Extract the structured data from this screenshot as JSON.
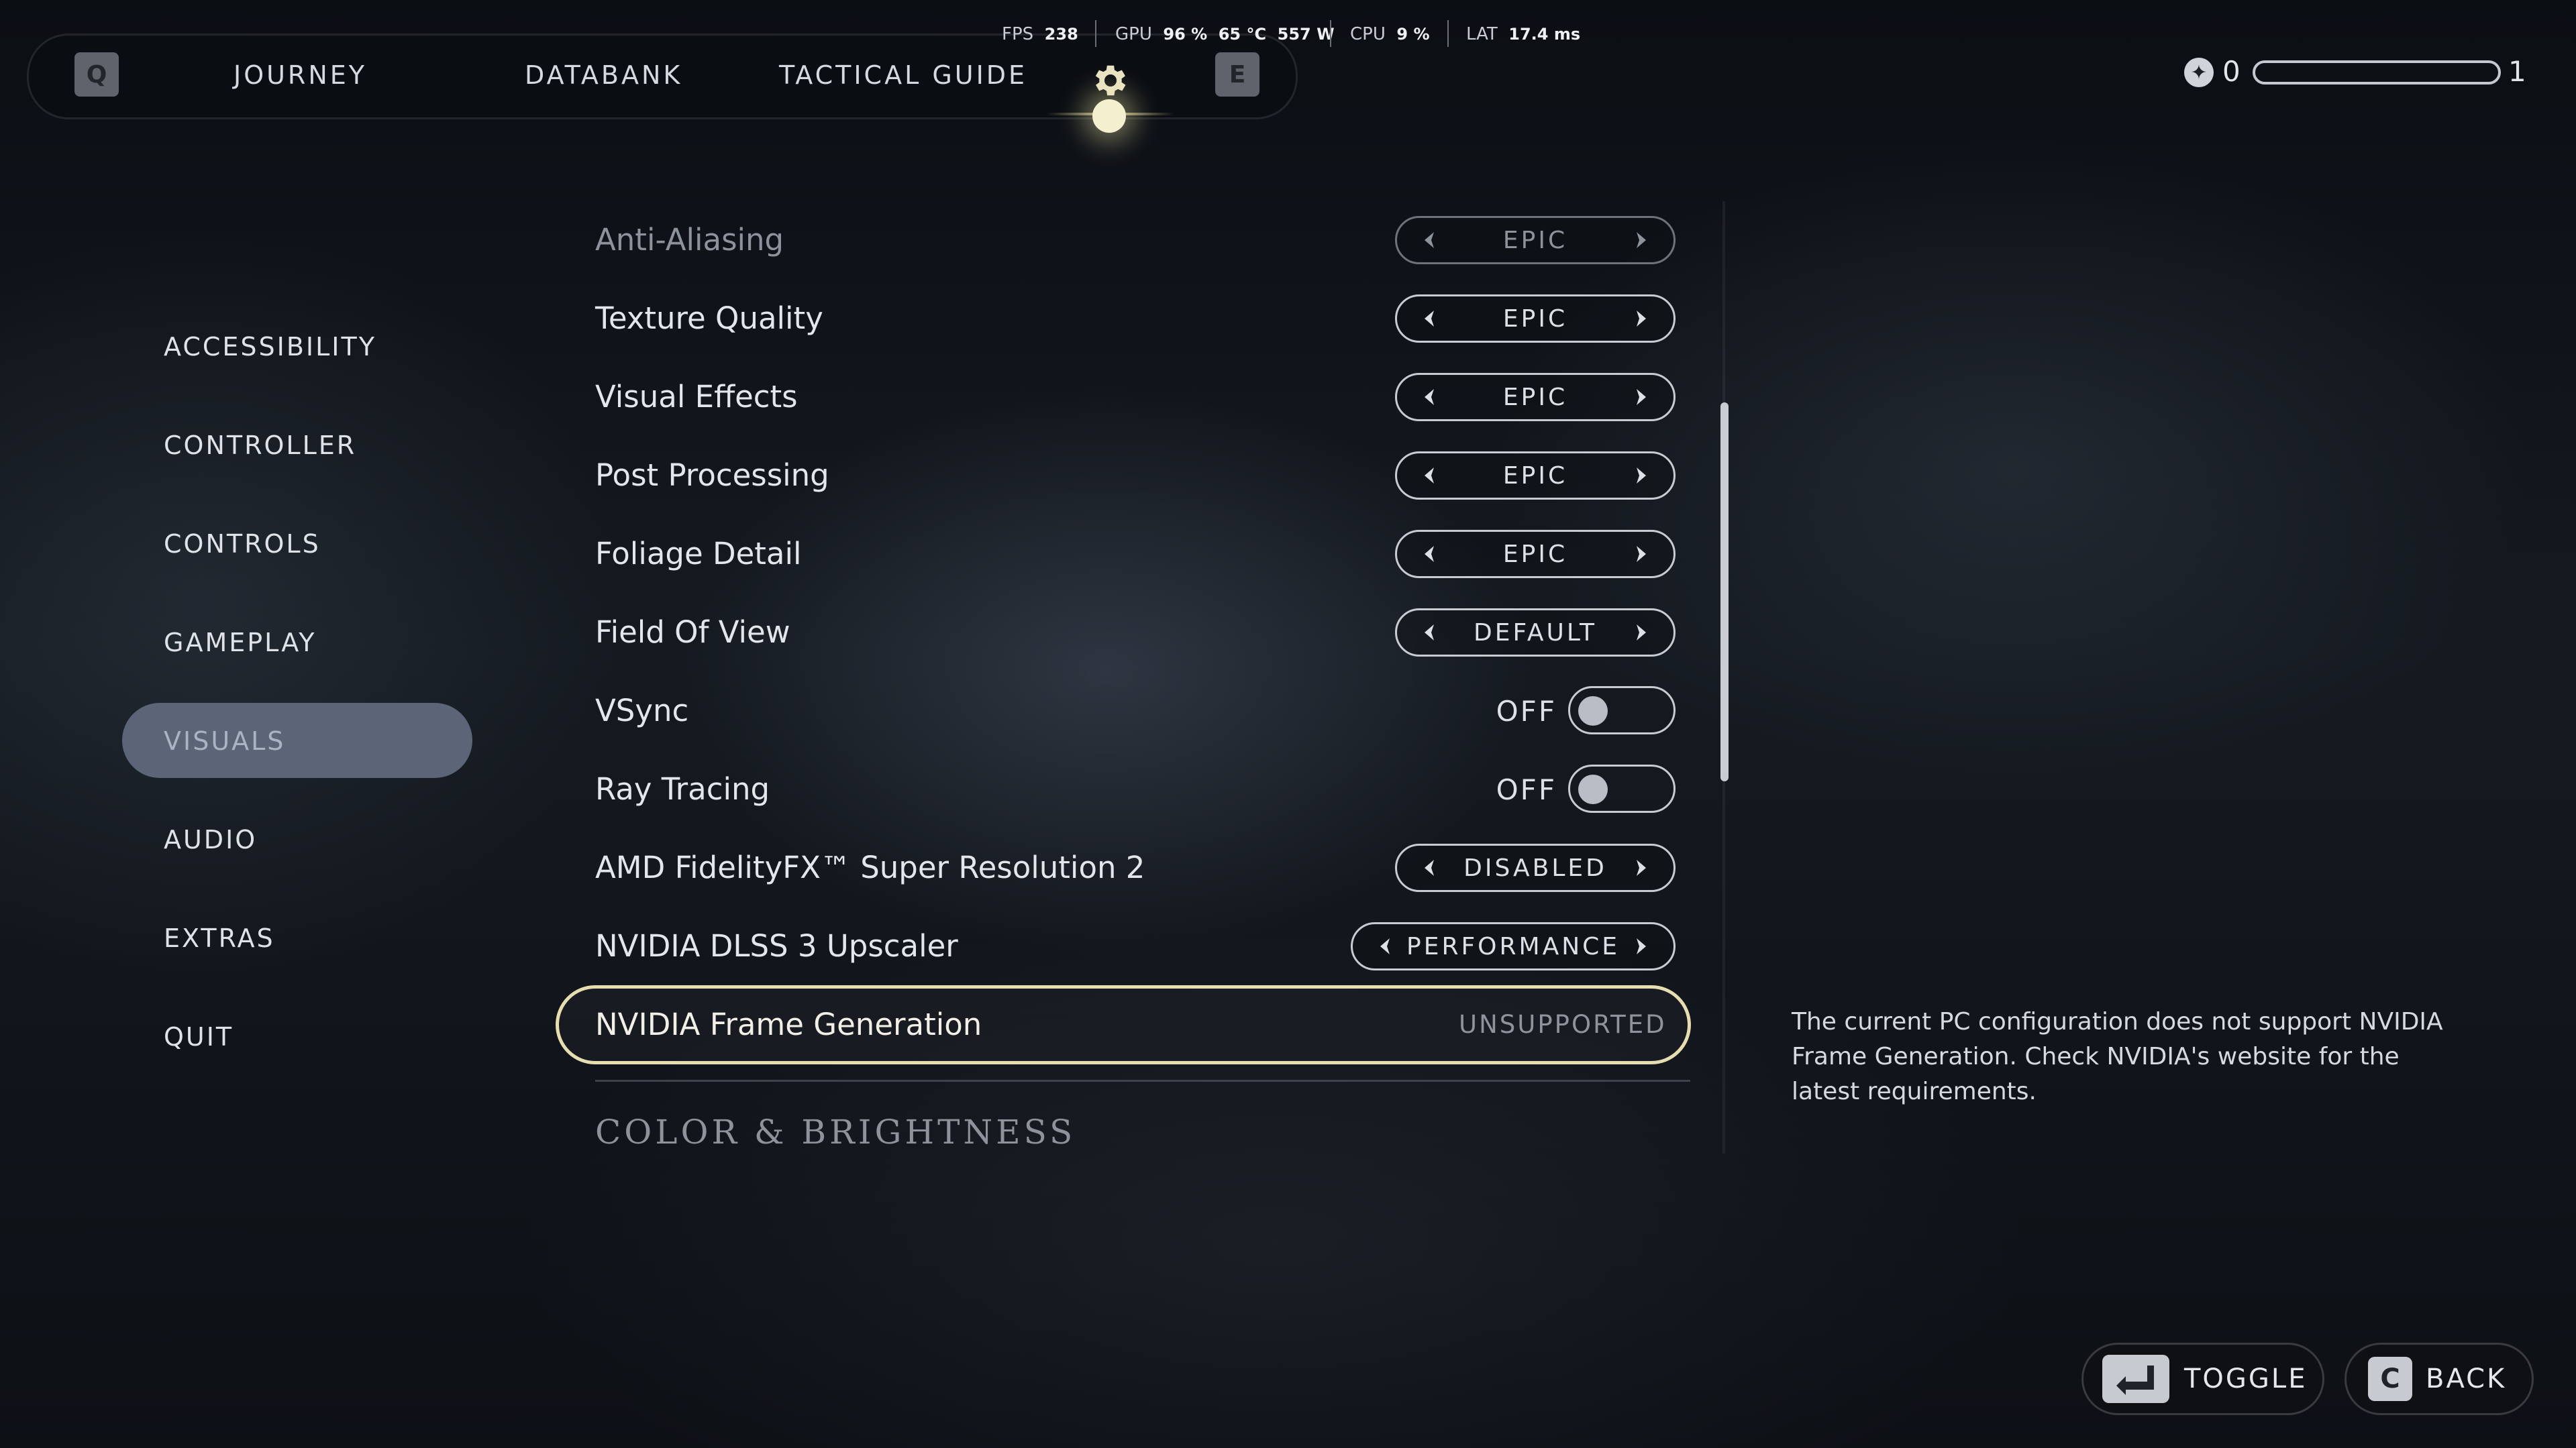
{
  "perf": {
    "fps_label": "FPS",
    "fps_value": "238",
    "gpu_label": "GPU",
    "gpu_usage": "96 %",
    "gpu_temp": "65 °C",
    "gpu_power": "557 W",
    "cpu_label": "CPU",
    "cpu_usage": "9 %",
    "lat_label": "LAT",
    "lat_value": "17.4 ms"
  },
  "nav": {
    "left_key": "Q",
    "right_key": "E",
    "tabs": [
      "JOURNEY",
      "DATABANK",
      "TACTICAL GUIDE"
    ],
    "active_icon": "gear-icon"
  },
  "xp": {
    "current": "0",
    "level_next": "1",
    "progress": 0
  },
  "sidebar": {
    "items": [
      "ACCESSIBILITY",
      "CONTROLLER",
      "CONTROLS",
      "GAMEPLAY",
      "VISUALS",
      "AUDIO",
      "EXTRAS",
      "QUIT"
    ],
    "active": "VISUALS"
  },
  "settings": {
    "anti_aliasing": {
      "label": "Anti-Aliasing",
      "value": "EPIC"
    },
    "texture_quality": {
      "label": "Texture Quality",
      "value": "EPIC"
    },
    "visual_effects": {
      "label": "Visual Effects",
      "value": "EPIC"
    },
    "post_processing": {
      "label": "Post Processing",
      "value": "EPIC"
    },
    "foliage_detail": {
      "label": "Foliage Detail",
      "value": "EPIC"
    },
    "field_of_view": {
      "label": "Field Of View",
      "value": "DEFAULT"
    },
    "vsync": {
      "label": "VSync",
      "value": "OFF"
    },
    "ray_tracing": {
      "label": "Ray Tracing",
      "value": "OFF"
    },
    "fsr2": {
      "label": "AMD FidelityFX™ Super Resolution 2",
      "value": "DISABLED"
    },
    "dlss": {
      "label": "NVIDIA DLSS 3 Upscaler",
      "value": "PERFORMANCE"
    },
    "frame_gen": {
      "label": "NVIDIA Frame Generation",
      "value": "UNSUPPORTED"
    }
  },
  "section_header": "COLOR & BRIGHTNESS",
  "description": "The current PC configuration does not support NVIDIA Frame Generation. Check NVIDIA's website for the latest requirements.",
  "buttons": {
    "toggle": {
      "key": "enter-key-icon",
      "label": "TOGGLE"
    },
    "back": {
      "key": "C",
      "label": "BACK"
    }
  },
  "colors": {
    "accent_glow": "#f4efcf",
    "focus_border": "#e6ddb0",
    "active_sidebar": "#5b6577"
  }
}
